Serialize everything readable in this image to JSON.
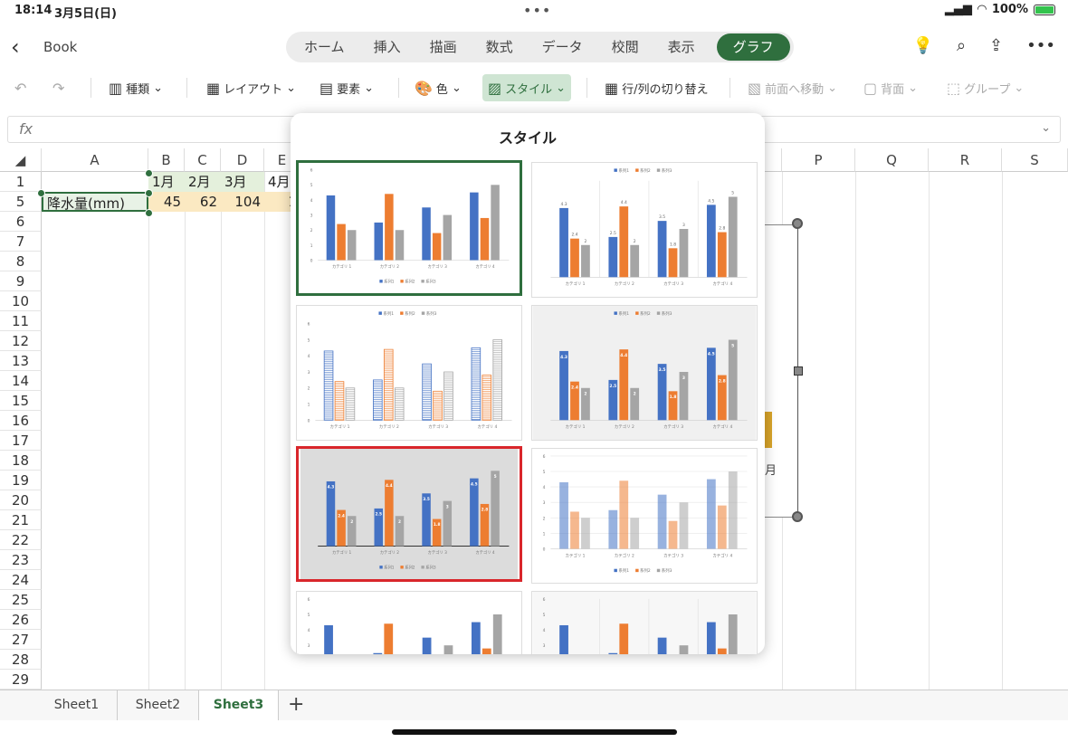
{
  "status": {
    "time": "18:14",
    "date": "3月5日(日)",
    "battery": "100%"
  },
  "app": {
    "back_label": "Book"
  },
  "ribbon_tabs": [
    {
      "label": "ホーム"
    },
    {
      "label": "挿入"
    },
    {
      "label": "描画"
    },
    {
      "label": "数式"
    },
    {
      "label": "データ"
    },
    {
      "label": "校閲"
    },
    {
      "label": "表示"
    },
    {
      "label": "グラフ"
    }
  ],
  "toolbar": {
    "type": "種類",
    "layout": "レイアウト",
    "elements": "要素",
    "color": "色",
    "style": "スタイル",
    "switch_rowcol": "行/列の切り替え",
    "bring_front": "前面へ移動",
    "send_back": "背面",
    "group": "グループ"
  },
  "formula": {
    "fx": "fx"
  },
  "columns": [
    "A",
    "B",
    "C",
    "D",
    "E",
    "P",
    "Q",
    "R",
    "S"
  ],
  "rows": [
    "1",
    "5",
    "6",
    "7",
    "8",
    "9",
    "10",
    "11",
    "12",
    "13",
    "14",
    "15",
    "16",
    "17",
    "18",
    "19",
    "20",
    "21",
    "22",
    "23",
    "24",
    "25",
    "26",
    "27",
    "28",
    "29"
  ],
  "cells": {
    "b1": "1月",
    "c1": "2月",
    "d1": "3月",
    "e1": "4月",
    "a5": "降水量(mm)",
    "b5": "45",
    "c5": "62",
    "d5": "104",
    "e5": "1"
  },
  "chart_fragment": {
    "label": "月"
  },
  "popover": {
    "title": "スタイル"
  },
  "chart_preview": {
    "categories": [
      "カテゴリ 1",
      "カテゴリ 2",
      "カテゴリ 3",
      "カテゴリ 4"
    ],
    "series": [
      {
        "name": "系列1",
        "values": [
          4.3,
          2.5,
          3.5,
          4.5
        ]
      },
      {
        "name": "系列2",
        "values": [
          2.4,
          4.4,
          1.8,
          2.8
        ]
      },
      {
        "name": "系列3",
        "values": [
          2,
          2,
          3,
          5
        ]
      }
    ],
    "ymax": 6,
    "colors": [
      "#4472c4",
      "#ed7d31",
      "#a5a5a5"
    ]
  },
  "sheets": [
    {
      "label": "Sheet1"
    },
    {
      "label": "Sheet2"
    },
    {
      "label": "Sheet3"
    }
  ],
  "add_sheet": "+"
}
